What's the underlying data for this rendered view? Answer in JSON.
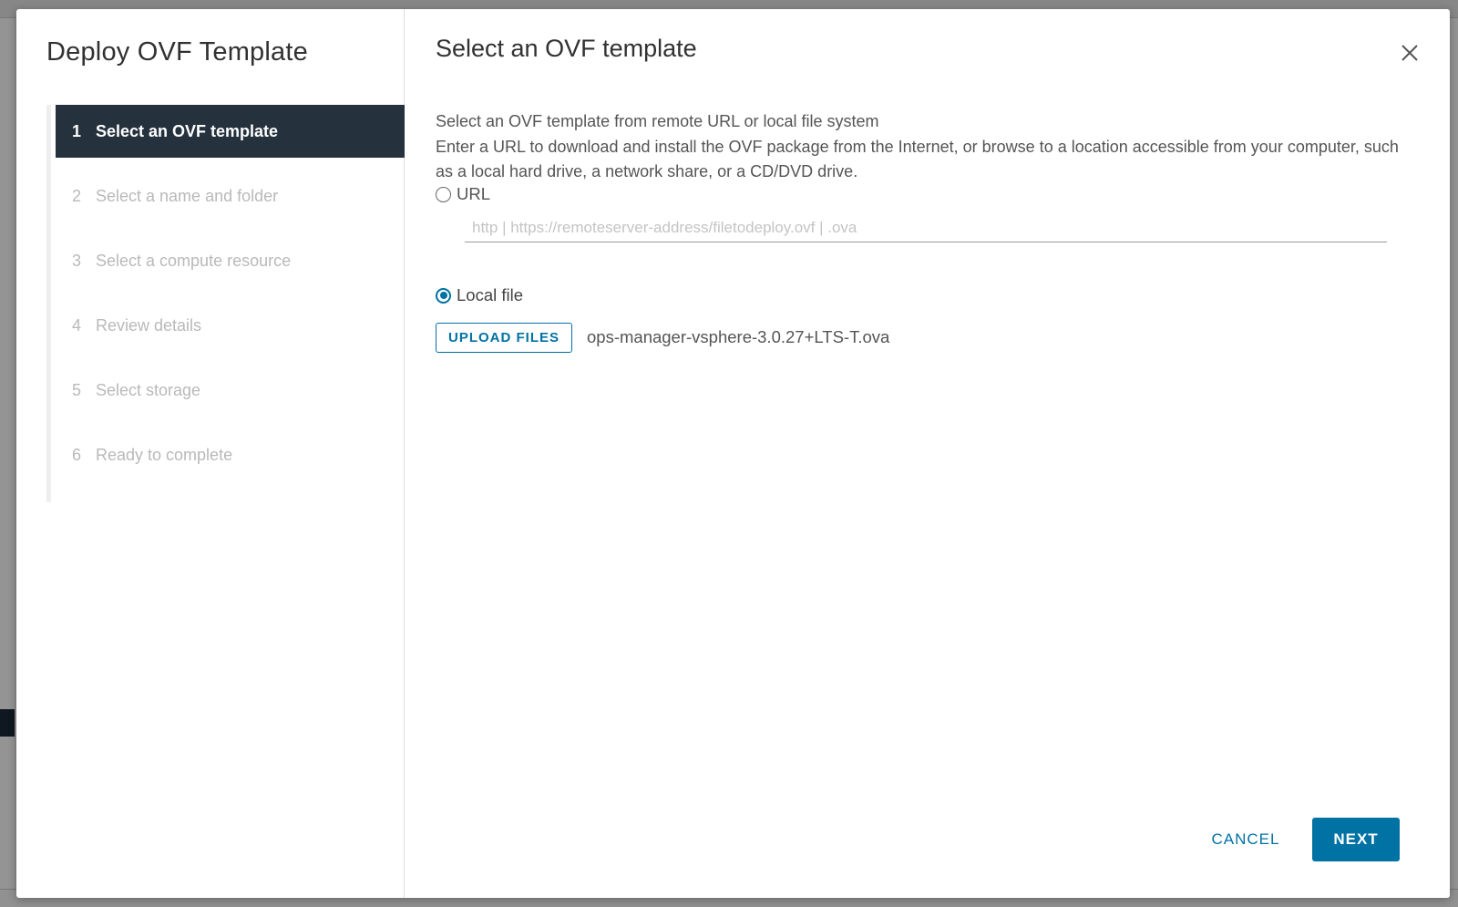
{
  "wizard": {
    "title": "Deploy OVF Template",
    "steps": [
      {
        "num": "1",
        "label": "Select an OVF template",
        "active": true
      },
      {
        "num": "2",
        "label": "Select a name and folder",
        "active": false
      },
      {
        "num": "3",
        "label": "Select a compute resource",
        "active": false
      },
      {
        "num": "4",
        "label": "Review details",
        "active": false
      },
      {
        "num": "5",
        "label": "Select storage",
        "active": false
      },
      {
        "num": "6",
        "label": "Ready to complete",
        "active": false
      }
    ]
  },
  "content": {
    "title": "Select an OVF template",
    "description_line1": "Select an OVF template from remote URL or local file system",
    "description_line2": "Enter a URL to download and install the OVF package from the Internet, or browse to a location accessible from your computer, such as a local hard drive, a network share, or a CD/DVD drive.",
    "url_option_label": "URL",
    "url_selected": false,
    "url_value": "",
    "url_placeholder": "http | https://remoteserver-address/filetodeploy.ovf | .ova",
    "local_option_label": "Local file",
    "local_selected": true,
    "upload_label": "UPLOAD FILES",
    "file_name": "ops-manager-vsphere-3.0.27+LTS-T.ova"
  },
  "footer": {
    "cancel_label": "CANCEL",
    "next_label": "NEXT"
  },
  "icons": {
    "close": "close-icon"
  },
  "colors": {
    "accent": "#0072a3",
    "active_step_bg": "#25313d"
  }
}
